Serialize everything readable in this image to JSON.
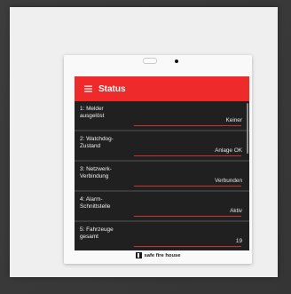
{
  "appbar": {
    "title": "Status",
    "menu_icon": "menu-icon",
    "color": "#ef2a2a"
  },
  "items": [
    {
      "label": "1: Melder\nausgelöst",
      "value": "Keiner"
    },
    {
      "label": "2: Watchdog-\nZustand",
      "value": "Anlage OK"
    },
    {
      "label": "3: Netzwerk-\nVerbindung",
      "value": "Verbunden"
    },
    {
      "label": "4: Alarm-\nSchnittstelle",
      "value": "Aktiv"
    },
    {
      "label": "5: Fahrzeuge\ngesamt",
      "value": "19"
    }
  ],
  "brand": {
    "text": "safe fire house",
    "logo_icon": "brand-logo-icon"
  },
  "colors": {
    "screen_bg": "#202020",
    "divider": "#3a3a3a",
    "underline": "#c83434"
  }
}
